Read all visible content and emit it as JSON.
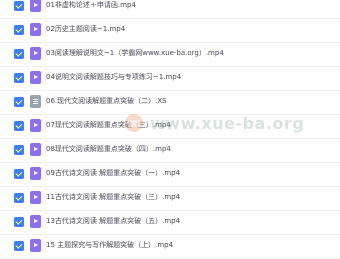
{
  "files": [
    {
      "name": "01非虚构论述＋申请函.mp4",
      "type": "video"
    },
    {
      "name": "02历史主题阅读~1.mp4",
      "type": "video"
    },
    {
      "name": "03阅读理解说明文~1（学霸网www.xue-ba.org）.mp4",
      "type": "video"
    },
    {
      "name": "04说明文阅读解题技巧与专项练习~1.mp4",
      "type": "video"
    },
    {
      "name": "06.现代文阅读解题重点突破（二）.XS",
      "type": "doc"
    },
    {
      "name": "07现代文阅读解题重点突破（三）.mp4",
      "type": "video"
    },
    {
      "name": "08现代文阅读解题重点突破（四）.mp4",
      "type": "video"
    },
    {
      "name": "09古代诗文阅读 解题重点突破（一）.mp4",
      "type": "video"
    },
    {
      "name": "11古代诗文阅读 解题重点突破（三）.mp4",
      "type": "video"
    },
    {
      "name": "13古代诗文阅读 解题重点突破（五）.mp4",
      "type": "video"
    },
    {
      "name": "15 主题探究与写作解题突破（上）.mp4",
      "type": "video"
    }
  ],
  "watermark": {
    "text": "www.xue-ba.org"
  }
}
